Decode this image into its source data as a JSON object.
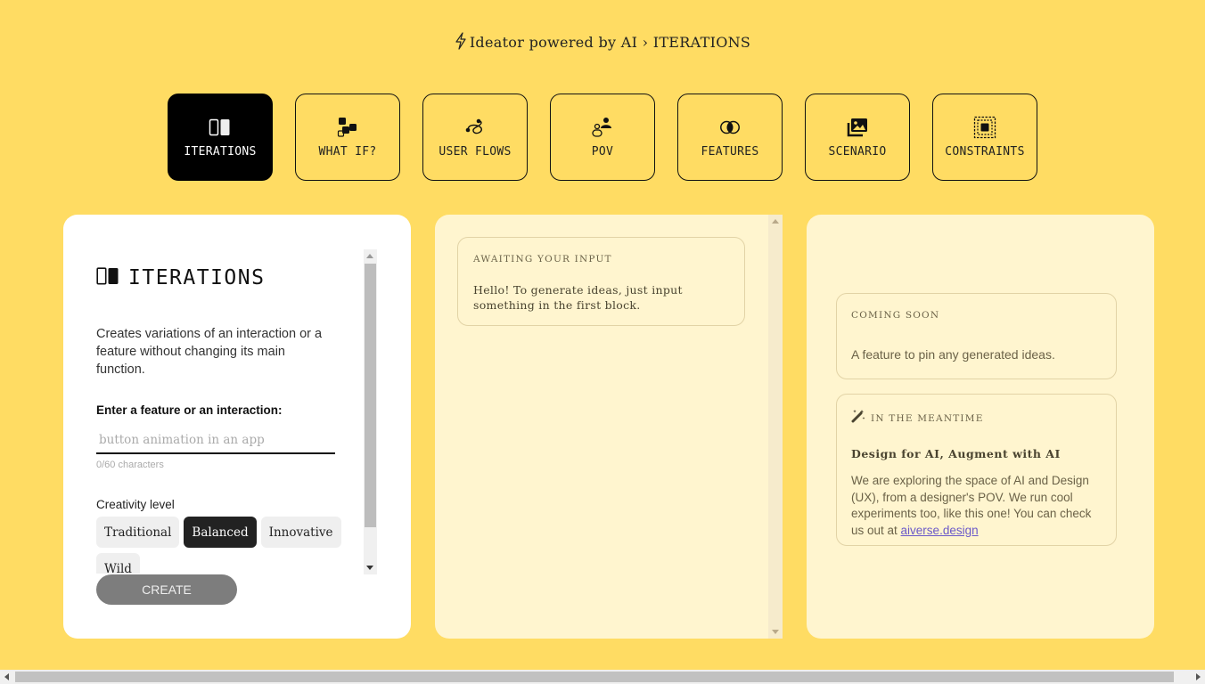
{
  "header": {
    "app_name": "Ideator powered by AI",
    "separator": "›",
    "current": "ITERATIONS"
  },
  "tabs": [
    {
      "label": "ITERATIONS",
      "icon": "columns-icon",
      "active": true
    },
    {
      "label": "WHAT IF?",
      "icon": "blocks-icon",
      "active": false
    },
    {
      "label": "USER FLOWS",
      "icon": "flow-icon",
      "active": false
    },
    {
      "label": "POV",
      "icon": "users-icon",
      "active": false
    },
    {
      "label": "FEATURES",
      "icon": "overlap-circles-icon",
      "active": false
    },
    {
      "label": "SCENARIO",
      "icon": "images-icon",
      "active": false
    },
    {
      "label": "CONSTRAINTS",
      "icon": "frame-icon",
      "active": false
    }
  ],
  "left_panel": {
    "title": "ITERATIONS",
    "description": "Creates variations of an interaction or a feature without changing its main function.",
    "input_label": "Enter a feature or an interaction:",
    "input_value": "",
    "input_placeholder": "button animation in an app",
    "char_count": "0/60 characters",
    "creativity_label": "Creativity level",
    "creativity_options": [
      "Traditional",
      "Balanced",
      "Innovative",
      "Wild"
    ],
    "creativity_selected": "Balanced",
    "create_label": "CREATE"
  },
  "middle_panel": {
    "eyebrow": "AWAITING YOUR INPUT",
    "message": "Hello! To generate ideas, just input something in the first block."
  },
  "right_panel": {
    "coming_soon": {
      "eyebrow": "COMING SOON",
      "message": "A feature to pin any generated ideas."
    },
    "meantime": {
      "eyebrow": "IN THE MEANTIME",
      "heading": "Design for AI, Augment with AI",
      "body": "We are exploring the space of AI and Design (UX), from a designer's POV. We run cool experiments too, like this one! You can check us out at ",
      "link_text": "aiverse.design"
    }
  },
  "colors": {
    "background": "#ffdc63",
    "panel_cream": "#fff5cf",
    "active_tab": "#000000",
    "link": "#6a58c9"
  }
}
